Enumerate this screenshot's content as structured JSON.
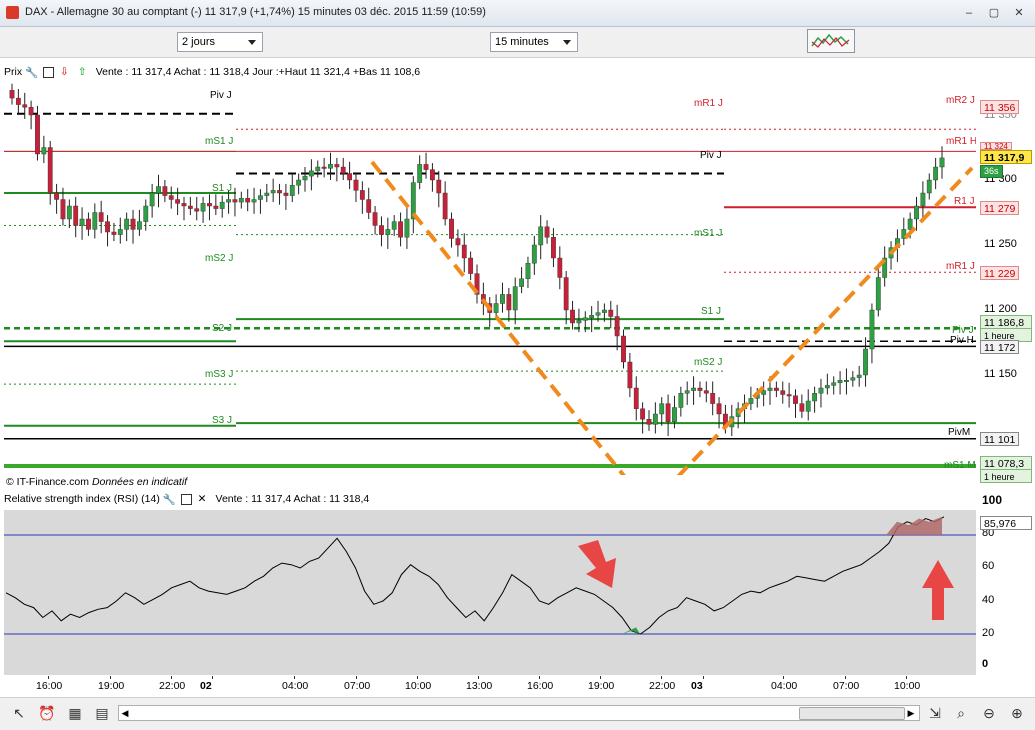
{
  "window": {
    "title": "DAX - Allemagne 30 au comptant (-)   11 317,9 (+1,74%)     15 minutes  03 déc. 2015 11:59 (10:59)",
    "buttons": [
      "–",
      "▢",
      "✕"
    ]
  },
  "toolbar": {
    "period_select": "2 jours",
    "interval_select": "15 minutes"
  },
  "price_panel": {
    "title": "Prix",
    "info": "Vente : 11 317,4 Achat : 11 318,4 Jour :+Haut 11 321,4 +Bas 11 108,6",
    "copyright": "© IT-Finance.com",
    "disclaimer": "Données en indicatif",
    "y_ticks": [
      "11 350",
      "11 300",
      "11 250",
      "11 200",
      "11 150"
    ],
    "level_labels": {
      "piv_j_left": "Piv J",
      "ms1_j_left": "mS1 J",
      "s1_j_left": "S1 J",
      "ms2_j_left": "mS2 J",
      "s2_j_left": "S2 J",
      "ms3_j_left": "mS3 J",
      "s3_j_left": "S3 J",
      "mr2_j_right": "mR2 J",
      "mr1_j_mid": "mR1 J",
      "mr1_h": "mR1 H",
      "piv_j_mid": "Piv J",
      "r1_j": "R1 J",
      "ms1_j_mid": "mS1 J",
      "mr1_j_right": "mR1 J",
      "s1_j_mid": "S1 J",
      "ms2_j_mid": "mS2 J",
      "piv_right": "Piv J",
      "piv_h": "Piv H",
      "pivm": "PivM",
      "ms1m": "mS1 M"
    },
    "price_tags": {
      "p11356": "11 356",
      "p11324": "11 324",
      "last": "11 317,9",
      "countdown": "36s",
      "p11279": "11 279",
      "p11229": "11 229",
      "p11186": "11 186,8",
      "p11186_sub": "1 heure",
      "p11172": "11 172",
      "p11101": "11 101",
      "p11078": "11 078,3",
      "p11078_sub": "1 heure"
    }
  },
  "rsi_panel": {
    "title": "Relative strength index (RSI) (14)",
    "info": "Vente : 11 317,4 Achat : 11 318,4",
    "y_ticks": [
      "100",
      "80",
      "60",
      "40",
      "20",
      "0"
    ],
    "value_tag": "85,976"
  },
  "x_axis": {
    "labels": [
      "16:00",
      "19:00",
      "22:00",
      "02",
      "04:00",
      "07:00",
      "10:00",
      "13:00",
      "16:00",
      "19:00",
      "22:00",
      "03",
      "04:00",
      "07:00",
      "10:00"
    ]
  },
  "colors": {
    "up": "#2ea043",
    "down": "#c7213a",
    "pivot": "#000000",
    "support": "#1f8a1f",
    "resistance": "#d01f2a",
    "annotation": "#f08a1c",
    "rsi_band": "#2b35b8"
  }
}
